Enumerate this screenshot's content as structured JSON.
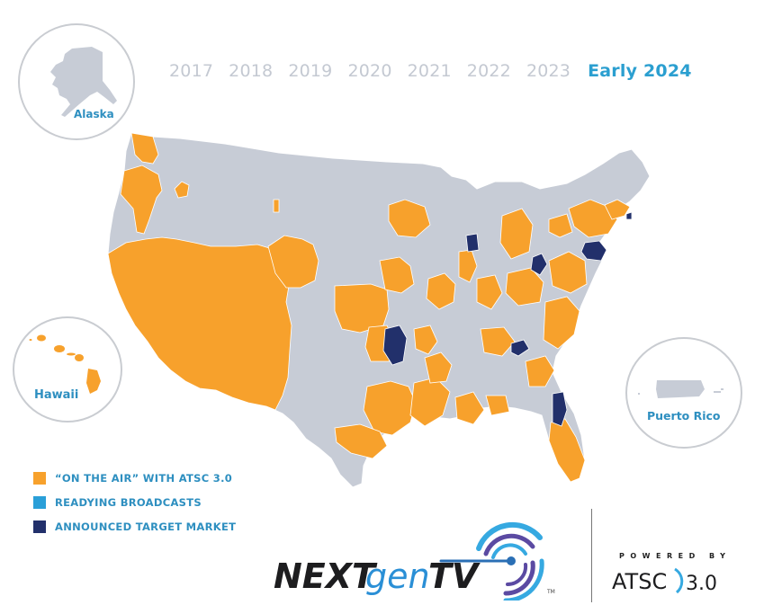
{
  "timeline": {
    "years": [
      "2017",
      "2018",
      "2019",
      "2020",
      "2021",
      "2022",
      "2023"
    ],
    "current": "Early 2024",
    "inactive_color": "#c4c9d2",
    "active_color": "#2b9fd0"
  },
  "insets": {
    "alaska": "Alaska",
    "hawaii": "Hawaii",
    "puerto_rico": "Puerto Rico"
  },
  "colors": {
    "on_air": "#f7a12c",
    "readying": "#2a9fd8",
    "announced": "#22306b",
    "no_service": "#c7ccd6",
    "border": "#ffffff"
  },
  "legend": [
    {
      "label": "“ON THE AIR” WITH ATSC 3.0",
      "status": "on_air",
      "color": "#f7a12c"
    },
    {
      "label": "READYING BROADCASTS",
      "status": "readying",
      "color": "#2a9fd8"
    },
    {
      "label": "ANNOUNCED TARGET MARKET",
      "status": "announced",
      "color": "#22306b"
    }
  ],
  "announced_markets_shown": [
    "Milwaukee area (WI)",
    "Toledo/Cleveland area (OH)",
    "Central Pennsylvania",
    "Providence (RI)",
    "Springfield/Joplin area (MO)",
    "Knoxville area (TN)",
    "Jacksonville area (FL)"
  ],
  "branding": {
    "logo_text_dark": "NEXT",
    "logo_text_blue": "gen",
    "logo_text_tv": "TV",
    "trademark": "TM",
    "powered_by": "POWERED BY",
    "atsc": "ATSC",
    "atsc_version": "3.0"
  }
}
